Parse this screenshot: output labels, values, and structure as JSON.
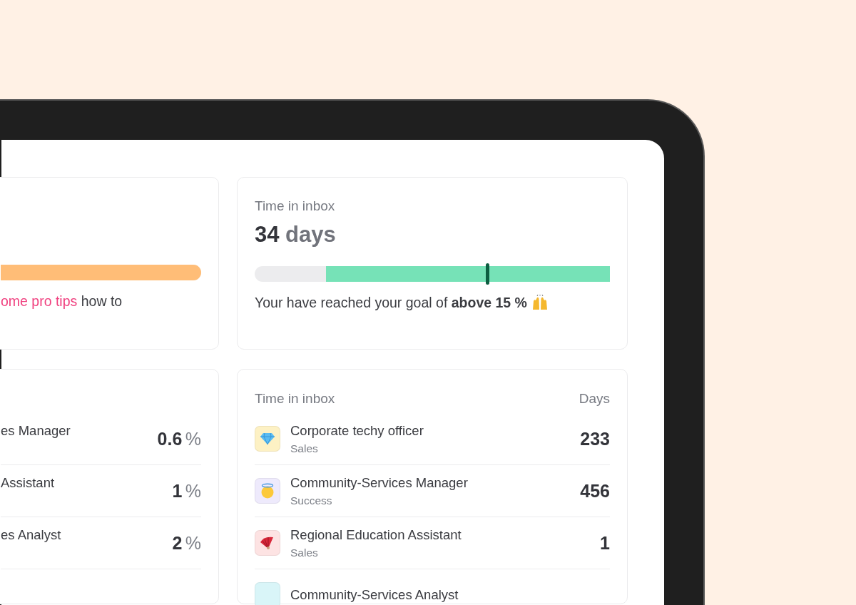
{
  "goal_card": {
    "bar": {
      "level": 1
    },
    "link": "ome pro tips",
    "text": "how to"
  },
  "inbox_card": {
    "title": "Time in inbox",
    "value": "34",
    "unit": "days",
    "bar": {
      "level": 0.8
    },
    "marker": {
      "level": 0.655
    },
    "message": "Your have reached your goal of **above 15 %**"
  },
  "percent_list": {
    "rows": [
      {
        "name": "es Manager",
        "value": "0.6",
        "unit": "%"
      },
      {
        "name": "Assistant",
        "value": "1",
        "unit": "%"
      },
      {
        "name": "es Analyst",
        "value": "2",
        "unit": "%"
      }
    ]
  },
  "inbox_list": {
    "title": "Time in inbox",
    "column": "Days",
    "rows": [
      {
        "name": "Corporate techy officer",
        "team": "Sales",
        "days": "233",
        "kind": "diamond",
        "color": "#fdf1c4"
      },
      {
        "name": "Community-Services Manager",
        "team": "Success",
        "days": "456",
        "kind": "halo",
        "color": "#eeeafc"
      },
      {
        "name": "Regional Education Assistant",
        "team": "Sales",
        "days": "1",
        "kind": "fan",
        "color": "#fde3e3"
      },
      {
        "name": "Community-Services Analyst",
        "kind": "plain",
        "color": "#d9f5f8"
      }
    ]
  }
}
